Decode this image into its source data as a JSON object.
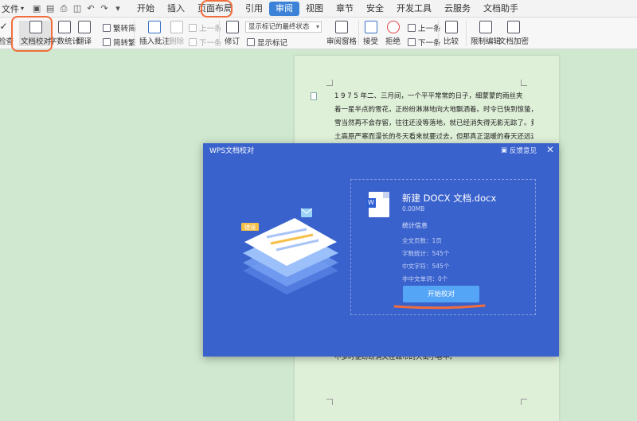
{
  "menubar": {
    "file_label": "文件",
    "tabs": [
      "开始",
      "插入",
      "页面布局",
      "引用",
      "审阅",
      "视图",
      "章节",
      "安全",
      "开发工具",
      "云服务",
      "文档助手"
    ],
    "active_tab": "审阅"
  },
  "ribbon": {
    "check": "检查",
    "doc_proofread": "文档校对",
    "word_count": "字数统计",
    "translate": "翻译",
    "trad_to_simp": "繁转简",
    "simp_to_trad": "简转繁",
    "insert_comment": "插入批注",
    "delete": "删除",
    "prev_comment": "上一条",
    "next_comment": "下一条",
    "revise": "修订",
    "markup_select": "显示标记的最终状态",
    "show_markup": "显示标记",
    "review_pane": "审阅窗格",
    "accept": "接受",
    "reject": "拒绝",
    "prev_change": "上一条",
    "next_change": "下一条",
    "compare": "比较",
    "restrict_editing": "限制编辑",
    "doc_encrypt": "文档加密"
  },
  "document": {
    "lines": [
      "1 9 7 5 年二、三月间，一个平平常常的日子，细蒙蒙的雨丝夹",
      "着一星半点的雪花，正纷纷淋淋地向大地飘洒着。时令已快到惊蛰，",
      "雪当然再不会存留，往往还没等落地，就已经消失得无影无踪了。黄",
      "土高原严寒而漫长的冬天看来就要过去，但那真正温暖的春天还远远"
    ],
    "bottom_line": "不多时便纷纷消失在城市的大街小巷中。"
  },
  "dialog": {
    "title": "WPS文档校对",
    "feedback": "反馈意见",
    "file_name": "新建 DOCX 文档.docx",
    "file_size": "0.00MB",
    "stats_title": "统计信息",
    "stats": [
      "全文页数：1页",
      "字数统计：545个",
      "中文字符：545个",
      "非中文单词：0个"
    ],
    "start_button": "开始校对",
    "illus_label": "错误"
  },
  "colors": {
    "accent": "#3b82d8",
    "highlight": "#f26d3c",
    "dialog_bg": "#3a62cc",
    "button": "#55a5f7",
    "page_bg": "#cfe8cf"
  }
}
